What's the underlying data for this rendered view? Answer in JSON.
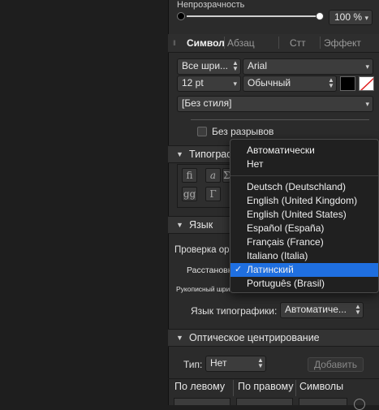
{
  "opacity": {
    "label": "Непрозрачность",
    "value": "100 %"
  },
  "tabs": [
    {
      "label": "Символ",
      "active": true
    },
    {
      "label": "Абзац",
      "active": false
    },
    {
      "label": "Стт",
      "active": false
    },
    {
      "label": "Эффект",
      "active": false
    }
  ],
  "font": {
    "collection": "Все шри...",
    "family": "Arial",
    "size": "12 pt",
    "style": "Обычный",
    "char_style": "[Без стиля]"
  },
  "no_break": {
    "label": "Без разрывов"
  },
  "sections": {
    "typography": "Типограф",
    "language": "Язык",
    "optical": "Оптическое центрирование"
  },
  "typo_glyphs": [
    "fi",
    "a",
    "Σ",
    "gg",
    "Γ"
  ],
  "language": {
    "spell_label": "Проверка ор",
    "hyphenation_label": "Расстановк",
    "handwriting_label": "Рукописный шриф",
    "typo_lang_label": "Язык типографики:",
    "typo_lang_value": "Автоматиче..."
  },
  "dropdown": {
    "items": [
      {
        "label": "Автоматически",
        "group": 1,
        "selected": false
      },
      {
        "label": "Нет",
        "group": 1,
        "selected": false
      },
      {
        "label": "Deutsch (Deutschland)",
        "group": 2,
        "selected": false
      },
      {
        "label": "English (United Kingdom)",
        "group": 2,
        "selected": false
      },
      {
        "label": "English (United States)",
        "group": 2,
        "selected": false
      },
      {
        "label": "Español (España)",
        "group": 2,
        "selected": false
      },
      {
        "label": "Français (France)",
        "group": 2,
        "selected": false
      },
      {
        "label": "Italiano (Italia)",
        "group": 2,
        "selected": false
      },
      {
        "label": "Латинский",
        "group": 2,
        "selected": true
      },
      {
        "label": "Português (Brasil)",
        "group": 2,
        "selected": false
      }
    ],
    "check": "✓"
  },
  "optical": {
    "type_label": "Тип:",
    "type_value": "Нет",
    "add_button": "Добавить"
  },
  "columns": [
    "По левому",
    "По правому",
    "Символы"
  ],
  "colors": {
    "accent": "#1f6fe0",
    "panel": "#2b2b2b",
    "control": "#3c3c3c"
  }
}
